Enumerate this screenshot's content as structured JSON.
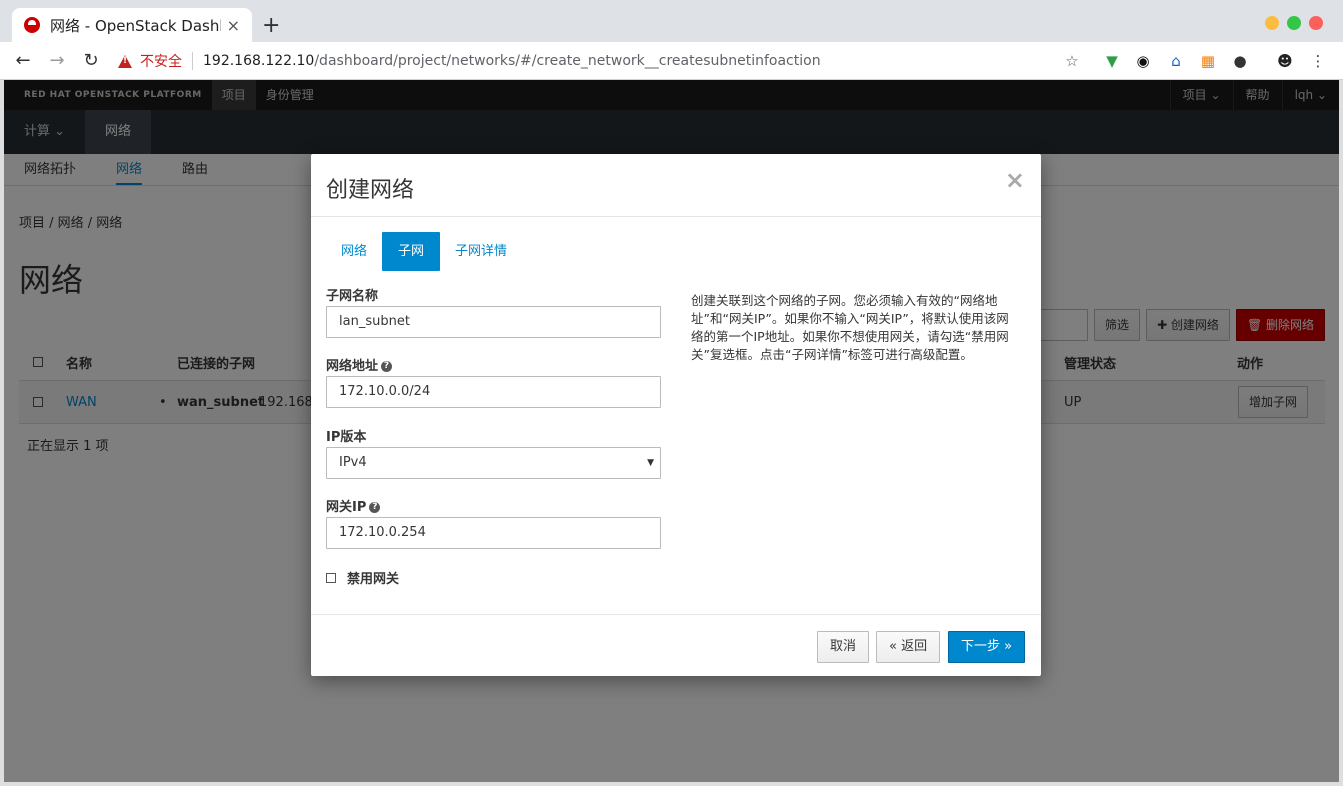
{
  "browser": {
    "tab_title": "网络 - OpenStack Dashboard",
    "tab_close": "×",
    "new_tab": "+",
    "security_label": "不安全",
    "url_host": "192.168.122.10",
    "url_path": "/dashboard/project/networks/#/create_network__createsubnetinfoaction"
  },
  "topbar": {
    "brand": "RED HAT OPENSTACK PLATFORM",
    "nav": [
      "项目",
      "身份管理"
    ],
    "right": [
      "项目 ⌄",
      "帮助",
      "lqh ⌄"
    ]
  },
  "secondary_nav": [
    "计算 ⌄",
    "网络"
  ],
  "tertiary_nav": [
    "网络拓扑",
    "网络",
    "路由"
  ],
  "breadcrumb": "项目 /  网络 /  网络",
  "page_title": "网络",
  "table_actions": {
    "filter": "筛选",
    "create": "✚ 创建网络",
    "delete": "🗑 删除网络"
  },
  "table": {
    "headers": [
      "名称",
      "已连接的子网",
      "管理状态",
      "动作"
    ],
    "rows": [
      {
        "name": "WAN",
        "subnet_name": "wan_subnet",
        "subnet_cidr": "192.168.",
        "admin_state": "UP",
        "action": "增加子网"
      }
    ],
    "footer": "正在显示 1 项"
  },
  "modal": {
    "title": "创建网络",
    "close": "×",
    "tabs": [
      "网络",
      "子网",
      "子网详情"
    ],
    "subnet_name_label": "子网名称",
    "subnet_name_value": "lan_subnet",
    "network_address_label": "网络地址",
    "network_address_value": "172.10.0.0/24",
    "ip_version_label": "IP版本",
    "ip_version_value": "IPv4",
    "gateway_label": "网关IP",
    "gateway_value": "172.10.0.254",
    "disable_gateway_label": "禁用网关",
    "help_text": "创建关联到这个网络的子网。您必须输入有效的“网络地址”和“网关IP”。如果你不输入“网关IP”，将默认使用该网络的第一个IP地址。如果你不想使用网关，请勾选“禁用网关”复选框。点击“子网详情”标签可进行高级配置。",
    "cancel": "取消",
    "back": "« 返回",
    "next": "下一步 »"
  },
  "colors": {
    "accent": "#0088ce",
    "danger": "#cc0000",
    "insecure": "#c5221f"
  }
}
